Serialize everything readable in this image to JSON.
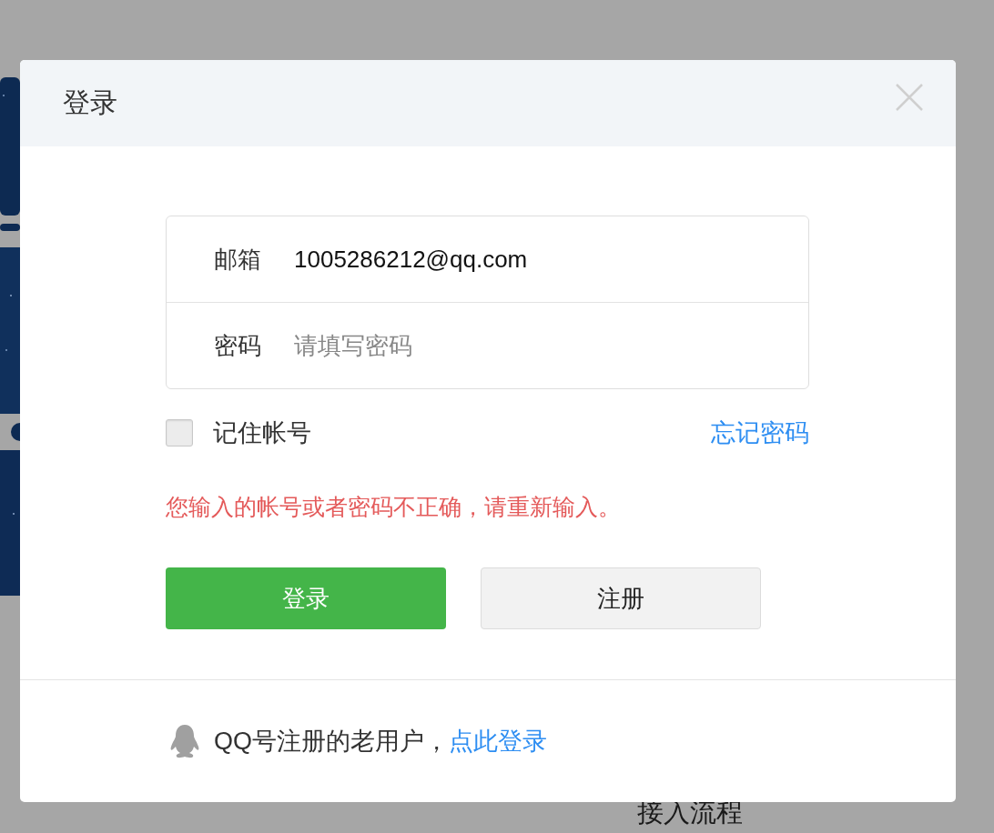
{
  "background": {
    "heading": "接入流程"
  },
  "dialog": {
    "title": "登录",
    "fields": [
      {
        "label": "邮箱",
        "value": "1005286212@qq.com"
      },
      {
        "label": "密码",
        "placeholder": "请填写密码"
      }
    ],
    "remember": {
      "label": "记住帐号",
      "checked": false
    },
    "forgot_link": "忘记密码",
    "error": "您输入的帐号或者密码不正确，请重新输入。",
    "buttons": [
      {
        "label": "登录",
        "kind": "primary"
      },
      {
        "label": "注册",
        "kind": "secondary"
      }
    ],
    "footer": {
      "text": "QQ号注册的老用户，",
      "link": "点此登录"
    }
  }
}
